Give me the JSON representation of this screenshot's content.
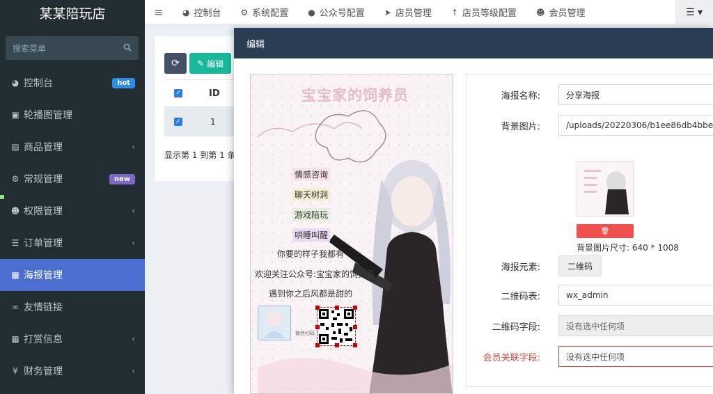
{
  "brand": "某某陪玩店",
  "search": {
    "placeholder": "搜索菜单"
  },
  "sidebar": {
    "items": [
      {
        "label": "控制台",
        "icon": "dashboard-icon",
        "badge": "hot"
      },
      {
        "label": "轮播图管理",
        "icon": "image-icon"
      },
      {
        "label": "商品管理",
        "icon": "book-icon",
        "chevron": "‹"
      },
      {
        "label": "常规管理",
        "icon": "cogs-icon",
        "badge": "new"
      },
      {
        "label": "权限管理",
        "icon": "users-icon",
        "chevron": "‹"
      },
      {
        "label": "订单管理",
        "icon": "list-icon",
        "chevron": "‹"
      },
      {
        "label": "海报管理",
        "icon": "picture-icon",
        "active": true
      },
      {
        "label": "友情链接",
        "icon": "link-icon"
      },
      {
        "label": "打赏信息",
        "icon": "gift-icon",
        "chevron": "‹"
      },
      {
        "label": "财务管理",
        "icon": "yen-icon",
        "chevron": "‹"
      }
    ]
  },
  "topnav": {
    "items": [
      {
        "label": "控制台",
        "icon": "dashboard-icon"
      },
      {
        "label": "系统配置",
        "icon": "cog-icon"
      },
      {
        "label": "公众号配置",
        "icon": "wechat-icon"
      },
      {
        "label": "店员管理",
        "icon": "send-icon"
      },
      {
        "label": "店员等级配置",
        "icon": "level-up-icon"
      },
      {
        "label": "会员管理",
        "icon": "user-icon"
      }
    ]
  },
  "toolbar": {
    "edit_label": "编辑"
  },
  "table": {
    "header_id": "ID",
    "row_id": "1",
    "pager": "显示第 1 到第 1 条"
  },
  "modal": {
    "title": "编辑"
  },
  "poster": {
    "title": "宝宝家的饲养员",
    "tags": [
      "情感咨询",
      "聊天树洞",
      "游戏陪玩",
      "哄睡叫醒"
    ],
    "lines": [
      "你要的样子我都有",
      "欢迎关注公众号:宝宝家的饲养员",
      "遇到你之后风都是甜的"
    ],
    "wx_label": "微信扫码"
  },
  "form": {
    "name_label": "海报名称:",
    "name_value": "分享海报",
    "bg_label": "背景图片:",
    "bg_value": "/uploads/20220306/b1ee86db4bbe",
    "bg_size": "背景图片尺寸: 640 * 1008",
    "elem_label": "海报元素:",
    "elem_btn": "二维码",
    "qr_table_label": "二维码表:",
    "qr_table_value": "wx_admin",
    "qr_field_label": "二维码字段:",
    "qr_field_value": "没有选中任何项",
    "member_field_label": "会员关联字段:",
    "member_field_value": "没有选中任何项"
  },
  "colors": {
    "sidebar_bg": "#222d32",
    "active_item": "#4a6fd1",
    "modal_header": "#2c3d53",
    "edit_button": "#18b99a",
    "delete_button": "#f05050",
    "error_label": "#e24b3b"
  }
}
